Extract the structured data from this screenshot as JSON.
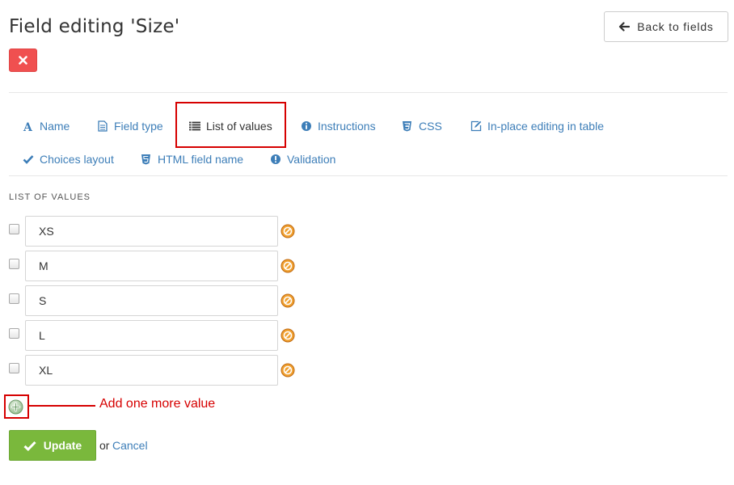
{
  "header": {
    "title": "Field editing 'Size'",
    "back_label": "Back to fields"
  },
  "tabs": [
    {
      "label": "Name",
      "icon": "font-icon"
    },
    {
      "label": "Field type",
      "icon": "document-icon"
    },
    {
      "label": "List of values",
      "icon": "list-icon",
      "active": true
    },
    {
      "label": "Instructions",
      "icon": "info-icon"
    },
    {
      "label": "CSS",
      "icon": "css3-icon"
    },
    {
      "label": "In-place editing in table",
      "icon": "edit-icon"
    },
    {
      "label": "Choices layout",
      "icon": "check-icon"
    },
    {
      "label": "HTML field name",
      "icon": "html5-icon"
    },
    {
      "label": "Validation",
      "icon": "exclamation-icon"
    }
  ],
  "list": {
    "section_label": "LIST OF VALUES",
    "values": [
      "XS",
      "M",
      "S",
      "L",
      "XL"
    ]
  },
  "annotation": {
    "text": "Add one more value"
  },
  "footer": {
    "update_label": "Update",
    "or_text": "or",
    "cancel_label": "Cancel"
  },
  "colors": {
    "link": "#3d7eb8",
    "danger": "#f05050",
    "success": "#7ab83c",
    "highlight": "#d60000"
  }
}
